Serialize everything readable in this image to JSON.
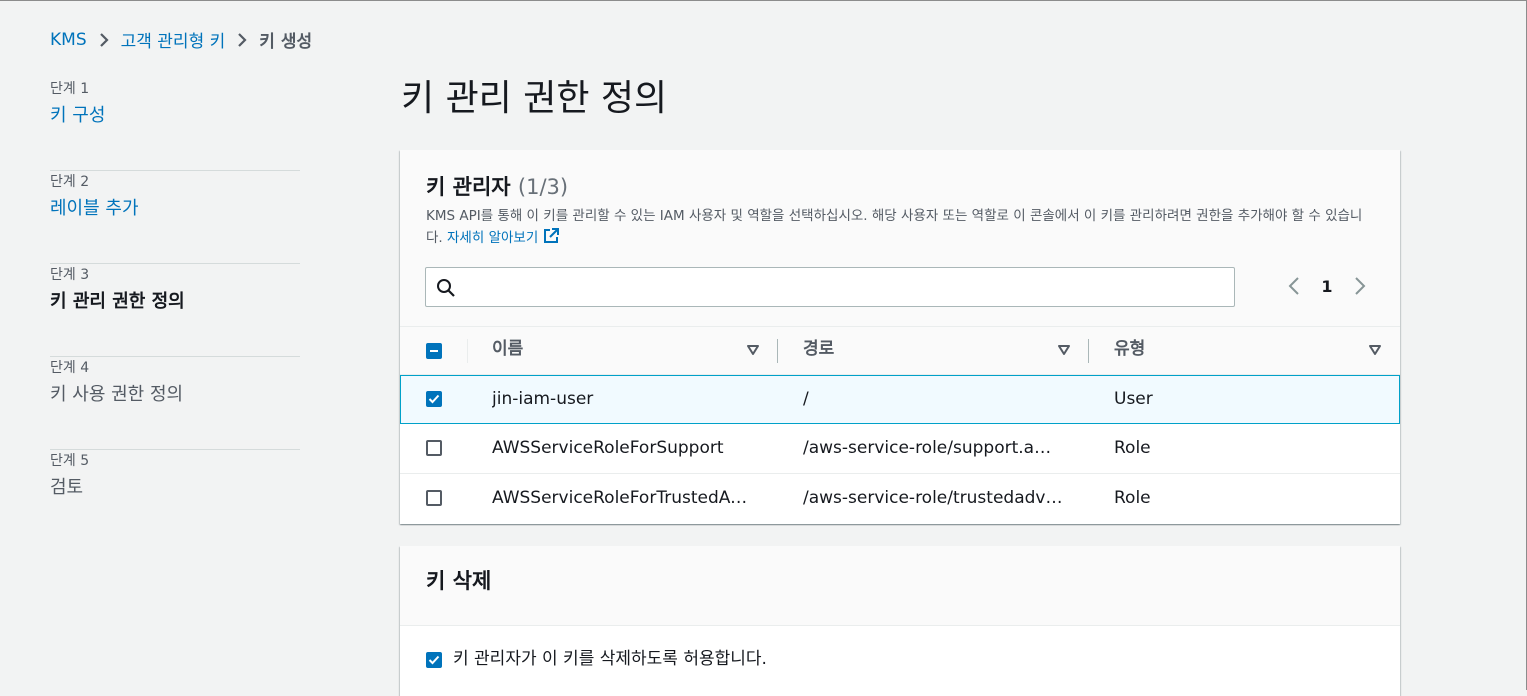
{
  "breadcrumb": {
    "items": [
      "KMS",
      "고객 관리형 키"
    ],
    "current": "키 생성"
  },
  "steps": [
    {
      "num": "단계 1",
      "label": "키 구성",
      "state": "link"
    },
    {
      "num": "단계 2",
      "label": "레이블 추가",
      "state": "link"
    },
    {
      "num": "단계 3",
      "label": "키 관리 권한 정의",
      "state": "active"
    },
    {
      "num": "단계 4",
      "label": "키 사용 권한 정의",
      "state": "disabled"
    },
    {
      "num": "단계 5",
      "label": "검토",
      "state": "disabled"
    }
  ],
  "page_title": "키 관리 권한 정의",
  "key_admins": {
    "title": "키 관리자",
    "count": "(1/3)",
    "description": "KMS API를 통해 이 키를 관리할 수 있는 IAM 사용자 및 역할을 선택하십시오. 해당 사용자 또는 역할로 이 콘솔에서 이 키를 관리하려면 권한을 추가해야 할 수 있습니다.",
    "learn_more": "자세히 알아보기",
    "search_placeholder": "",
    "search_value": "",
    "page": "1",
    "columns": [
      "이름",
      "경로",
      "유형"
    ],
    "rows": [
      {
        "name": "jin-iam-user",
        "path": "/",
        "type": "User",
        "selected": true
      },
      {
        "name": "AWSServiceRoleForSupport",
        "path": "/aws-service-role/support.amazonaws.com/",
        "type": "Role",
        "selected": false
      },
      {
        "name": "AWSServiceRoleForTrustedAdvisor",
        "path": "/aws-service-role/trustedadvisor.amazonaws.com/",
        "type": "Role",
        "selected": false
      }
    ]
  },
  "key_deletion": {
    "title": "키 삭제",
    "option_label": "키 관리자가 이 키를 삭제하도록 허용합니다.",
    "option_checked": true
  },
  "colors": {
    "accent": "#0073bb",
    "page_bg": "#f2f3f3",
    "text": "#16191f",
    "muted": "#545b64"
  }
}
